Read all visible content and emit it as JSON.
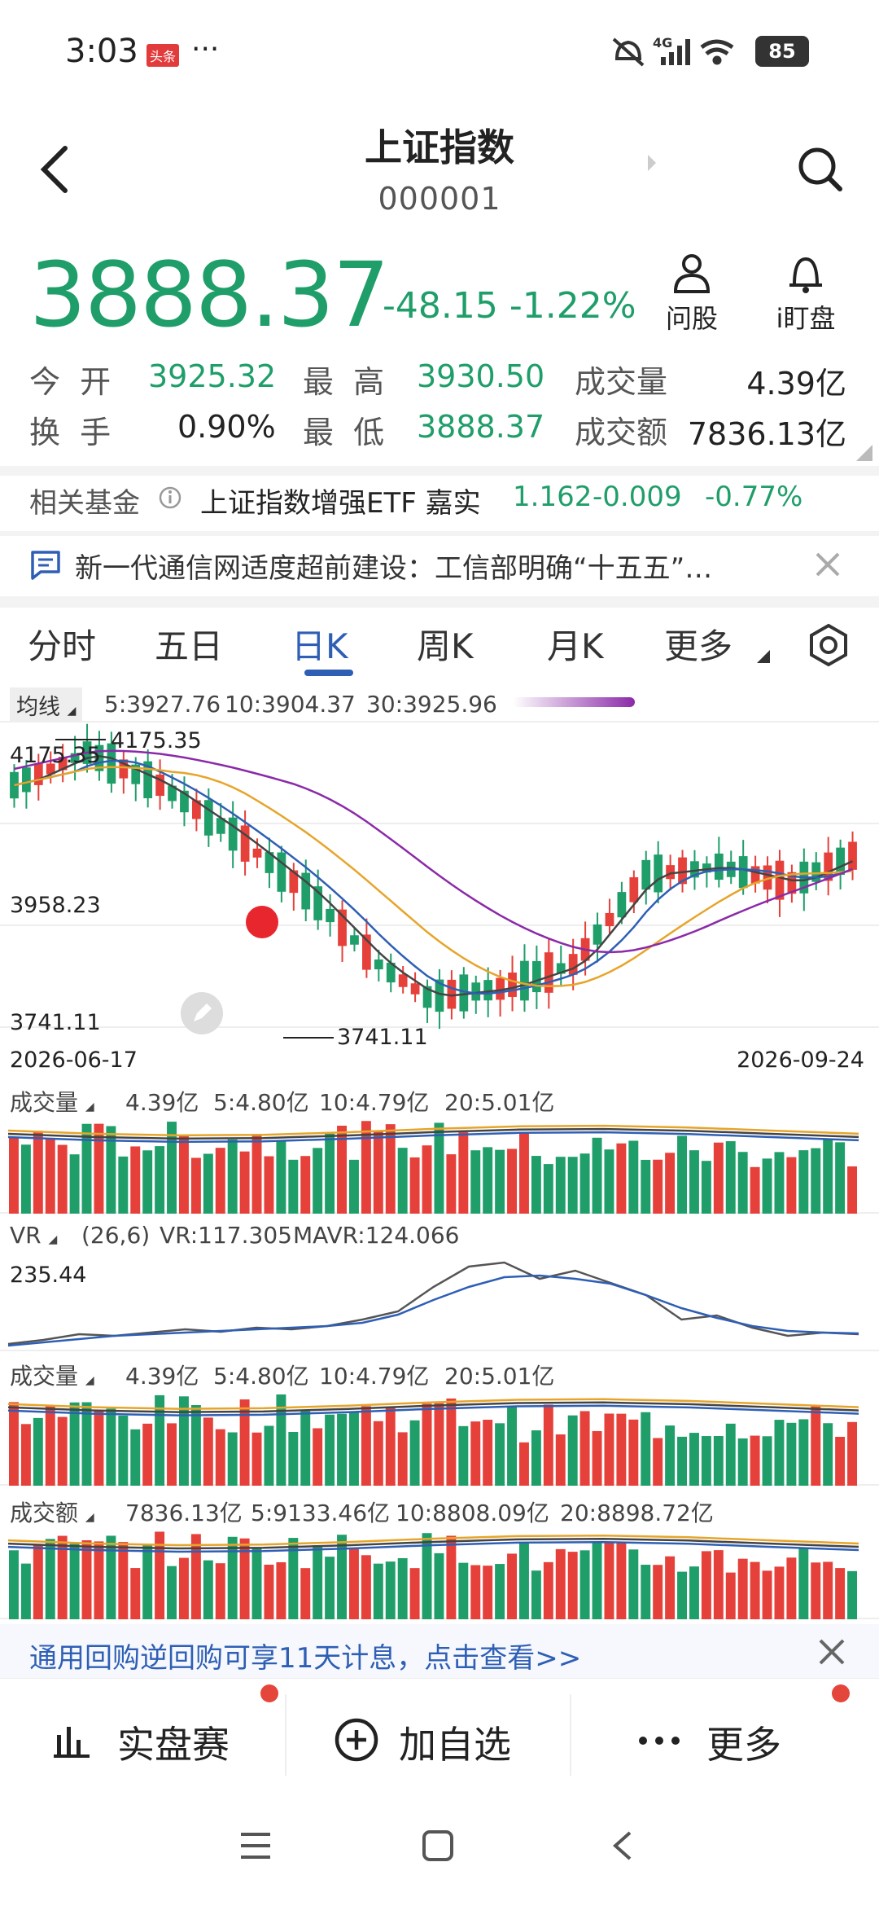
{
  "status_bar": {
    "time": "3:03",
    "app_badge": "头条",
    "more": "···",
    "network": "4G",
    "battery": "85"
  },
  "header": {
    "title": "上证指数",
    "code": "000001"
  },
  "quote": {
    "price": "3888.37",
    "change": "-48.15",
    "change_pct": "-1.22%"
  },
  "actions": [
    {
      "label": "问股",
      "icon": "person-icon"
    },
    {
      "label": "i盯盘",
      "icon": "bell-icon"
    }
  ],
  "stats": [
    {
      "label": "今 开",
      "value": "3925.32"
    },
    {
      "label": "最 高",
      "value": "3930.50"
    },
    {
      "label": "成交量",
      "value": "4.39亿"
    },
    {
      "label": "换 手",
      "value": "0.90%"
    },
    {
      "label": "最 低",
      "value": "3888.37"
    },
    {
      "label": "成交额",
      "value": "7836.13亿"
    }
  ],
  "fund": {
    "label": "相关基金",
    "name": "上证指数增强ETF 嘉实",
    "nav": "1.162",
    "change": "-0.009",
    "change_pct": "-0.77%"
  },
  "news": {
    "text": "新一代通信网适度超前建设：工信部明确“十五五”…"
  },
  "tabs": [
    {
      "label": "分时"
    },
    {
      "label": "五日"
    },
    {
      "label": "日K",
      "active": true
    },
    {
      "label": "周K"
    },
    {
      "label": "月K"
    },
    {
      "label": "更多"
    }
  ],
  "ma": {
    "label": "均线",
    "ma5": "5:3927.76",
    "ma10": "10:3904.37",
    "ma30": "30:3925.96"
  },
  "kline": {
    "y_top": "4175.35",
    "y_mid": "3958.23",
    "y_bottom": "3741.11",
    "max_label": "4175.35",
    "min_label": "3741.11",
    "date_start": "2026-06-17",
    "date_end": "2026-09-24"
  },
  "volume1": {
    "label": "成交量",
    "v": "4.39亿",
    "ma5": "5:4.80亿",
    "ma10": "10:4.79亿",
    "ma20": "20:5.01亿"
  },
  "vr": {
    "label": "VR",
    "param": "(26,6)",
    "vr": "VR:117.305",
    "mavr": "MAVR:124.066",
    "y_top": "235.44"
  },
  "volume2": {
    "label": "成交量",
    "v": "4.39亿",
    "ma5": "5:4.80亿",
    "ma10": "10:4.79亿",
    "ma20": "20:5.01亿"
  },
  "amount": {
    "label": "成交额",
    "v": "7836.13亿",
    "ma5": "5:9133.46亿",
    "ma10": "10:8808.09亿",
    "ma20": "20:8898.72亿"
  },
  "promo": {
    "text": "通用回购逆回购可享11天计息，点击查看>>"
  },
  "bottom": [
    {
      "label": "实盘赛"
    },
    {
      "label": "加自选"
    },
    {
      "label": "更多"
    }
  ],
  "colors": {
    "up": "#e5403a",
    "down": "#1f9e6a",
    "ma5": "#444444",
    "ma10": "#2e5fb5",
    "ma30": "#e6a52a",
    "ma60": "#8a2aa8"
  }
}
